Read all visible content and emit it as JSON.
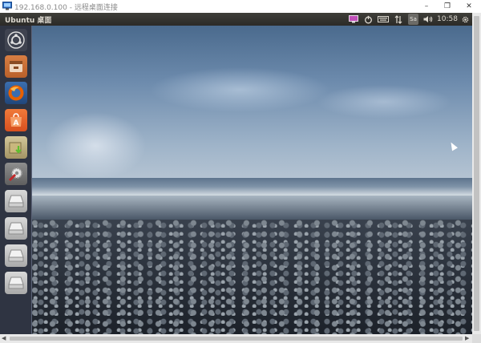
{
  "window": {
    "title": "192.168.0.100 - 远程桌面连接",
    "buttons": {
      "minimize": "–",
      "restore": "❐",
      "close": "✕"
    }
  },
  "panel": {
    "title": "Ubuntu 桌面",
    "indicators": {
      "display": "display-icon",
      "power": "power-icon",
      "keyboard": "keyboard-icon",
      "network": "network-icon",
      "input_method": "Sa",
      "volume": "volume-icon",
      "settings": "gear-icon"
    },
    "time": "10:58"
  },
  "launcher": {
    "items": [
      {
        "name": "dash",
        "icon": "ubuntu-logo-icon"
      },
      {
        "name": "files",
        "icon": "file-manager-icon"
      },
      {
        "name": "firefox",
        "icon": "firefox-icon"
      },
      {
        "name": "software-center",
        "icon": "software-center-icon"
      },
      {
        "name": "archive-manager",
        "icon": "archive-install-icon"
      },
      {
        "name": "system-settings",
        "icon": "system-settings-icon"
      },
      {
        "name": "drive-1",
        "icon": "drive-icon"
      },
      {
        "name": "drive-2",
        "icon": "drive-icon"
      },
      {
        "name": "drive-3",
        "icon": "drive-icon"
      },
      {
        "name": "drive-4",
        "icon": "drive-icon"
      }
    ]
  },
  "colors": {
    "panel_bg": "#2f2e2b",
    "launcher_bg": "#323746",
    "firefox": "#e66000",
    "software_center": "#e95420"
  }
}
